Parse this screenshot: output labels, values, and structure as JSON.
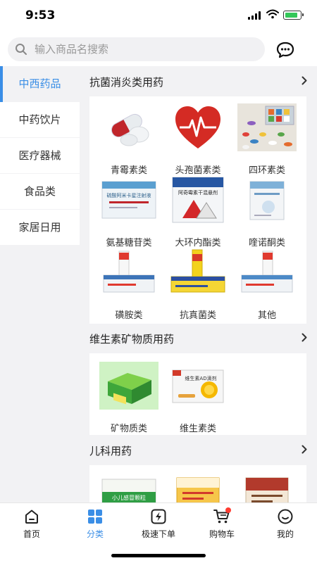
{
  "status": {
    "time": "9:53"
  },
  "search": {
    "placeholder": "输入商品名搜索"
  },
  "sidebar": {
    "items": [
      {
        "label": "中西药品",
        "active": true
      },
      {
        "label": "中药饮片"
      },
      {
        "label": "医疗器械"
      },
      {
        "label": "食品类"
      },
      {
        "label": "家居日用"
      }
    ]
  },
  "sections": [
    {
      "title": "抗菌消炎类用药",
      "items": [
        {
          "label": "青霉素类",
          "icon": "capsule-pill-image"
        },
        {
          "label": "头孢菌素类",
          "icon": "heart-pulse-image"
        },
        {
          "label": "四环素类",
          "icon": "pills-assortment-image"
        },
        {
          "label": "氨基糖苷类",
          "icon": "medicine-box-image"
        },
        {
          "label": "大环内酯类",
          "icon": "medicine-box-image"
        },
        {
          "label": "喹诺酮类",
          "icon": "medicine-box-image"
        },
        {
          "label": "磺胺类",
          "icon": "ointment-tube-image"
        },
        {
          "label": "抗真菌类",
          "icon": "ointment-tube-image"
        },
        {
          "label": "其他",
          "icon": "ointment-tube-image"
        }
      ]
    },
    {
      "title": "维生素矿物质用药",
      "items": [
        {
          "label": "矿物质类",
          "icon": "green-medicine-box-image"
        },
        {
          "label": "维生素类",
          "icon": "vitamin-box-image"
        }
      ]
    },
    {
      "title": "儿科用药",
      "items": [
        {
          "label": "",
          "icon": "pediatric-box-image"
        },
        {
          "label": "",
          "icon": "pediatric-box-image"
        },
        {
          "label": "",
          "icon": "pediatric-box-image"
        }
      ]
    }
  ],
  "box_text": {
    "amikacin": "硫酸阿米卡星注射液",
    "erythromycin": "阿奇霉素干混悬剂",
    "vitamin": "维生素AD滴剂",
    "kids_granule": "小儿感冒颗粒"
  },
  "tabbar": {
    "tabs": [
      {
        "label": "首页",
        "icon": "home-icon"
      },
      {
        "label": "分类",
        "icon": "category-grid-icon",
        "active": true
      },
      {
        "label": "极速下单",
        "icon": "lightning-icon"
      },
      {
        "label": "购物车",
        "icon": "cart-icon"
      },
      {
        "label": "我的",
        "icon": "profile-smile-icon"
      }
    ]
  },
  "colors": {
    "accent": "#3a8ee6",
    "background": "#f2f2f4",
    "badge": "#ff3b30"
  }
}
